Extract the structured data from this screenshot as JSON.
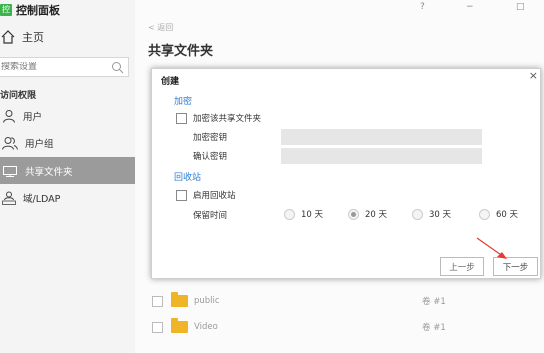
{
  "app": {
    "logo_text": "控制",
    "title": "控制面板"
  },
  "window": {
    "help": "?",
    "minimize": "−",
    "maximize": "□"
  },
  "sidebar": {
    "home_label": "主页",
    "search_placeholder": "搜索设置",
    "section_title": "访问权限",
    "items": [
      {
        "label": "用户",
        "icon": "user-icon",
        "active": false
      },
      {
        "label": "用户组",
        "icon": "group-icon",
        "active": false
      },
      {
        "label": "共享文件夹",
        "icon": "shared-folder-icon",
        "active": true
      },
      {
        "label": "域/LDAP",
        "icon": "ldap-icon",
        "active": false
      }
    ]
  },
  "main": {
    "back_label": "< 返回",
    "page_title": "共享文件夹",
    "rows": [
      {
        "name": "public",
        "owner": "卷 #1"
      },
      {
        "name": "Video",
        "owner": "卷 #1"
      }
    ]
  },
  "dialog": {
    "title": "创建",
    "close": "×",
    "encryption": {
      "section": "加密",
      "checkbox_label": "加密该共享文件夹",
      "key_label": "加密密钥",
      "confirm_label": "确认密钥",
      "key_value": "",
      "confirm_value": ""
    },
    "recycle": {
      "section": "回收站",
      "checkbox_label": "启用回收站",
      "retention_label": "保留时间",
      "options": [
        "10 天",
        "20 天",
        "30 天",
        "60 天"
      ],
      "selected": "20 天"
    },
    "buttons": {
      "prev": "上一步",
      "next": "下一步"
    }
  },
  "colors": {
    "accent": "#2c7ad6",
    "active_nav": "#9b9b9b",
    "folder": "#f0b429",
    "arrow": "#e53935"
  }
}
